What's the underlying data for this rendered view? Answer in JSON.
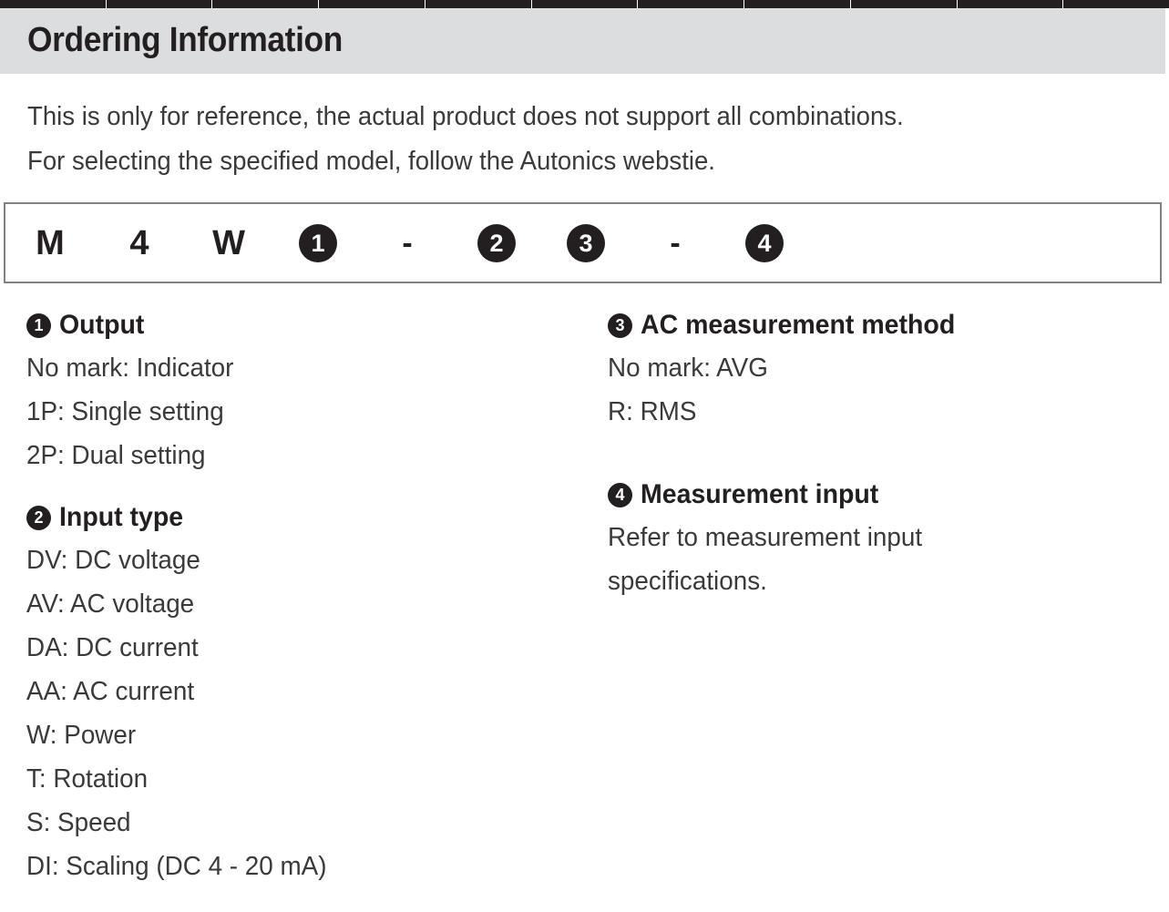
{
  "header": {
    "title": "Ordering Information",
    "band_color": "#dcdddf",
    "rule_color": "#231f20",
    "rule_segments": 11
  },
  "intro": {
    "line1": "This is only for reference, the actual product does not support all combinations.",
    "line2": "For selecting the specified model, follow the Autonics webstie."
  },
  "model_code": {
    "cells": [
      {
        "type": "text",
        "value": "M"
      },
      {
        "type": "text",
        "value": "4"
      },
      {
        "type": "text",
        "value": "W"
      },
      {
        "type": "badge",
        "value": "1"
      },
      {
        "type": "dash",
        "value": "-"
      },
      {
        "type": "badge",
        "value": "2"
      },
      {
        "type": "badge",
        "value": "3"
      },
      {
        "type": "dash",
        "value": "-"
      },
      {
        "type": "badge",
        "value": "4"
      }
    ]
  },
  "sections": {
    "output": {
      "number": "1",
      "title": "Output",
      "options": [
        "No mark: Indicator",
        "1P: Single setting",
        "2P: Dual setting"
      ]
    },
    "input_type": {
      "number": "2",
      "title": "Input type",
      "options": [
        "DV: DC voltage",
        "AV: AC voltage",
        "DA: DC current",
        "AA: AC current",
        "W: Power",
        "T: Rotation",
        "S: Speed",
        "DI: Scaling (DC 4 - 20 mA)"
      ]
    },
    "ac_measurement_method": {
      "number": "3",
      "title": "AC measurement method",
      "options": [
        "No mark: AVG",
        "R: RMS"
      ]
    },
    "measurement_input": {
      "number": "4",
      "title": "Measurement input",
      "note_line1": "Refer to measurement input",
      "note_line2": "specifications."
    }
  }
}
